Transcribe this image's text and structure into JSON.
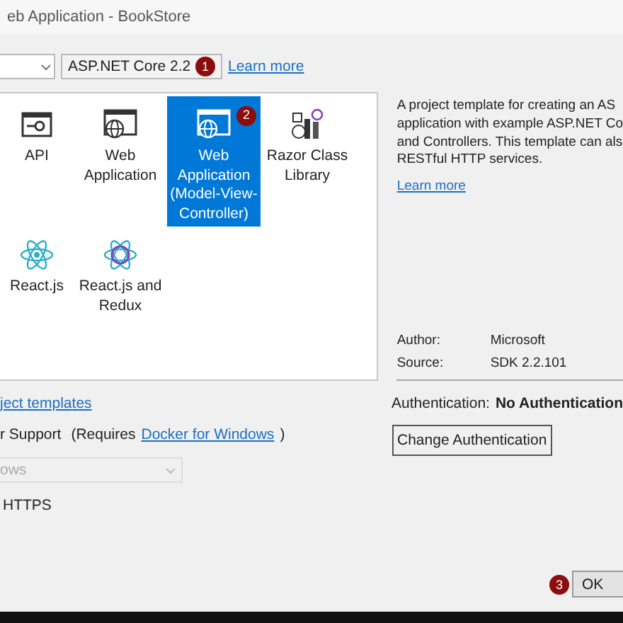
{
  "window": {
    "title": "eb Application - BookStore"
  },
  "framework": {
    "value": "ASP.NET Core 2.2",
    "badge": "1",
    "learn_more": "Learn more"
  },
  "templates": [
    {
      "name": "API",
      "kind": "api",
      "selected": false
    },
    {
      "name": "Web Application",
      "kind": "web",
      "selected": false
    },
    {
      "name": "Web Application (Model-View-Controller)",
      "kind": "web",
      "selected": true,
      "badge": "2"
    },
    {
      "name": "Razor Class Library",
      "kind": "library",
      "selected": false
    },
    {
      "name": "React.js",
      "kind": "react",
      "selected": false
    },
    {
      "name": "React.js and Redux",
      "kind": "redux",
      "selected": false
    }
  ],
  "description": {
    "lines": [
      "A project template for creating an AS",
      "application with example ASP.NET Co",
      "and Controllers. This template can als",
      "RESTful HTTP services."
    ],
    "learn_more": "Learn more",
    "author_label": "Author:",
    "author": "Microsoft",
    "source_label": "Source:",
    "source": "SDK 2.2.101"
  },
  "more_templates_link": "ject templates",
  "docker": {
    "label": "r Support",
    "note_prefix": "(Requires",
    "link": "Docker for Windows",
    "note_suffix": ")"
  },
  "os_dropdown": {
    "value": "ows",
    "disabled": true
  },
  "https": {
    "label": "HTTPS"
  },
  "authentication": {
    "label": "Authentication:",
    "value": "No Authentication",
    "button": "Change Authentication"
  },
  "ok_button": {
    "label": "OK",
    "badge": "3"
  }
}
